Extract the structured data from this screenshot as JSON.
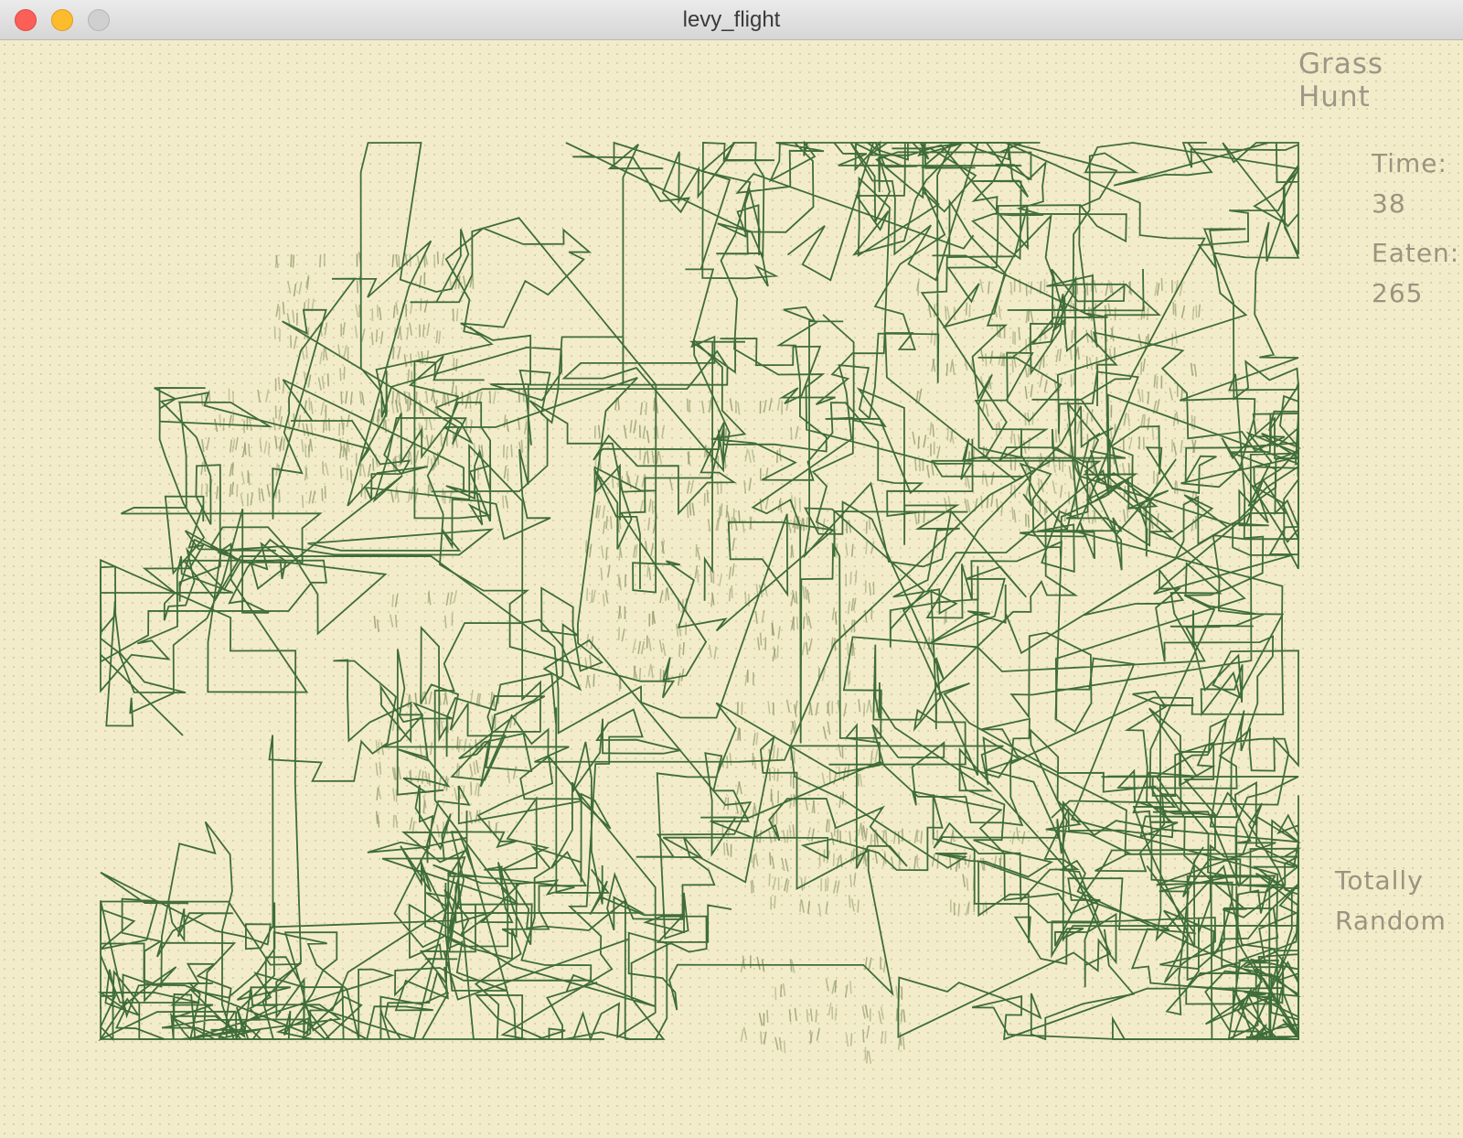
{
  "window": {
    "title": "levy_flight"
  },
  "hud": {
    "game_title": "Grass Hunt",
    "time_label": "Time:",
    "time_value": "38",
    "eaten_label": "Eaten:",
    "eaten_value": "265",
    "mode_line1": "Totally",
    "mode_line2": "Random"
  },
  "colors": {
    "background": "#f3ecca",
    "path": "#3f6d3a",
    "grass": "#8f9a6a",
    "hud_text": "#9a9480"
  }
}
